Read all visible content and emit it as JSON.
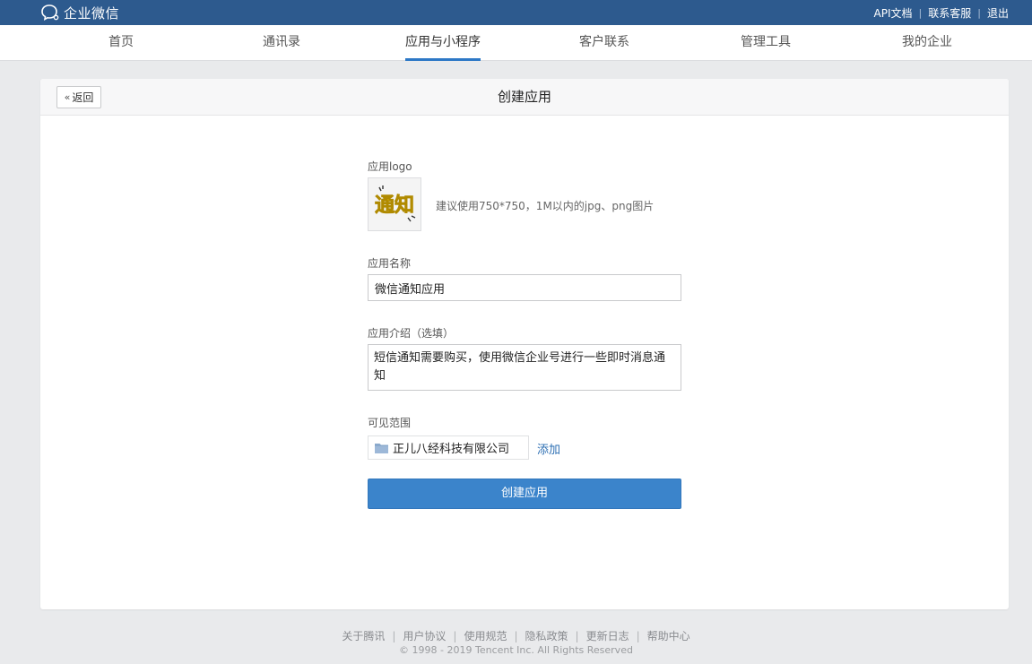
{
  "brand": {
    "name": "企业微信",
    "colors": {
      "topbar": "#2d5a8e",
      "accent": "#2d78c6",
      "primary_button": "#3b84cb",
      "link": "#2d6fb3"
    }
  },
  "toplinks": [
    {
      "label": "API文档"
    },
    {
      "label": "联系客服"
    },
    {
      "label": "退出"
    }
  ],
  "nav": {
    "items": [
      {
        "label": "首页"
      },
      {
        "label": "通讯录"
      },
      {
        "label": "应用与小程序",
        "active": true
      },
      {
        "label": "客户联系"
      },
      {
        "label": "管理工具"
      },
      {
        "label": "我的企业"
      }
    ]
  },
  "card": {
    "back_label": "返回",
    "back_icon": "double-chevron-left-icon",
    "title": "创建应用"
  },
  "form": {
    "logo_label": "应用logo",
    "logo_image_text": "通知",
    "logo_hint": "建议使用750*750，1M以内的jpg、png图片",
    "name_label": "应用名称",
    "name_value": "微信通知应用",
    "intro_label": "应用介绍（选填）",
    "intro_value": "短信通知需要购买，使用微信企业号进行一些即时消息通知",
    "scope_label": "可见范围",
    "scope_value": "正儿八经科技有限公司",
    "scope_icon": "folder-icon",
    "add_label": "添加",
    "submit_label": "创建应用"
  },
  "footer": {
    "links": [
      {
        "label": "关于腾讯"
      },
      {
        "label": "用户协议"
      },
      {
        "label": "使用规范"
      },
      {
        "label": "隐私政策"
      },
      {
        "label": "更新日志"
      },
      {
        "label": "帮助中心"
      }
    ],
    "copyright": "© 1998 - 2019 Tencent Inc. All Rights Reserved"
  }
}
